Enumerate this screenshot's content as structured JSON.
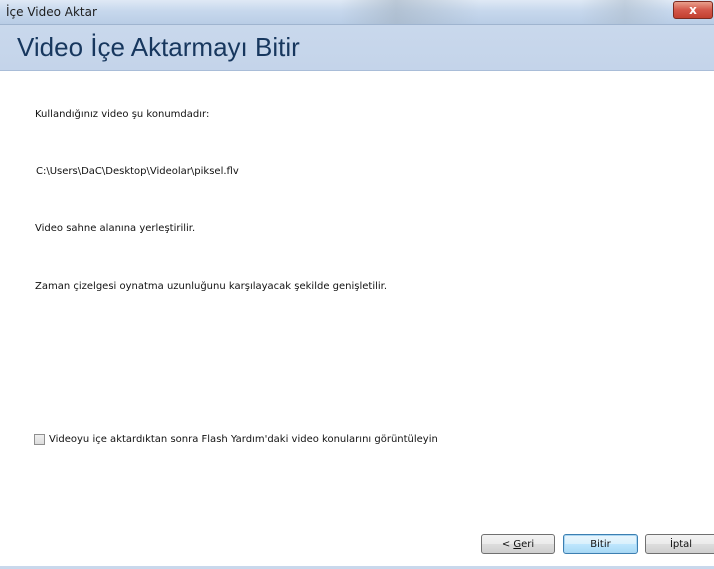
{
  "window": {
    "title": "İçe Video Aktar",
    "close_label": "x"
  },
  "header": {
    "title": "Video İçe Aktarmayı Bitir"
  },
  "content": {
    "location_intro": "Kullandığınız video şu konumdadır:",
    "video_path": "C:\\Users\\DaC\\Desktop\\Videolar\\piksel.flv",
    "stage_note": "Video sahne alanına yerleştirilir.",
    "timeline_note": "Zaman çizelgesi oynatma uzunluğunu karşılayacak şekilde genişletilir.",
    "help_checkbox": {
      "label": "Videoyu içe aktardıktan sonra Flash Yardım'daki video konularını görüntüleyin",
      "checked": false
    }
  },
  "buttons": {
    "back_prefix": "< ",
    "back_accel": "G",
    "back_rest": "eri",
    "finish_label": "Bitir",
    "cancel_label": "İptal"
  },
  "colors": {
    "header_bg": "#c9d8ec",
    "header_text": "#17375e",
    "close_button": "#c2402f",
    "default_button_border": "#3c7fb1"
  }
}
